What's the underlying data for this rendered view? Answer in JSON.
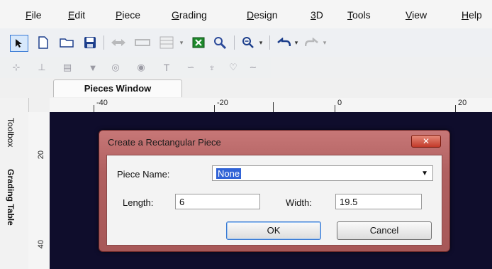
{
  "menu": [
    "File",
    "Edit",
    "Piece",
    "Grading",
    "Design",
    "3D",
    "Tools",
    "View",
    "Help"
  ],
  "toolbar": {
    "icons": [
      "pointer-icon",
      "new-icon",
      "open-icon",
      "save-icon",
      "flip-icon",
      "stitch-icon",
      "layout-icon",
      "export-icon",
      "settings-icon",
      "zoom-icon",
      "undo-icon",
      "redo-icon"
    ]
  },
  "tabs": {
    "pieces_window": "Pieces Window"
  },
  "side_tabs": [
    "Toolbox",
    "Grading Table"
  ],
  "rulers": {
    "h_labels": [
      "-40",
      "-20",
      "0",
      "20"
    ],
    "v_labels": [
      "20",
      "40"
    ]
  },
  "dialog": {
    "title": "Create a Rectangular Piece",
    "close": "✕",
    "piece_name_label": "Piece Name:",
    "piece_name_value": "None",
    "length_label": "Length:",
    "length_value": "6",
    "width_label": "Width:",
    "width_value": "19.5",
    "ok": "OK",
    "cancel": "Cancel"
  },
  "colors": {
    "canvas": "#0f0d2c",
    "dialog_frame": "#b06060",
    "selection": "#3163d6"
  }
}
